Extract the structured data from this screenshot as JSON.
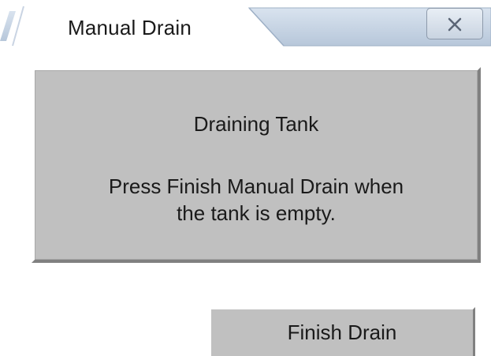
{
  "window": {
    "tab_title": "Manual Drain",
    "close_icon": "close-x-icon"
  },
  "panel": {
    "heading": "Draining Tank",
    "message_line1": "Press Finish Manual Drain when",
    "message_line2": "the tank is empty."
  },
  "actions": {
    "finish_label": "Finish Drain"
  },
  "colors": {
    "panel_background": "#c0c0c0",
    "tab_bar": "#c9d6e6",
    "text": "#1a1a1a"
  }
}
